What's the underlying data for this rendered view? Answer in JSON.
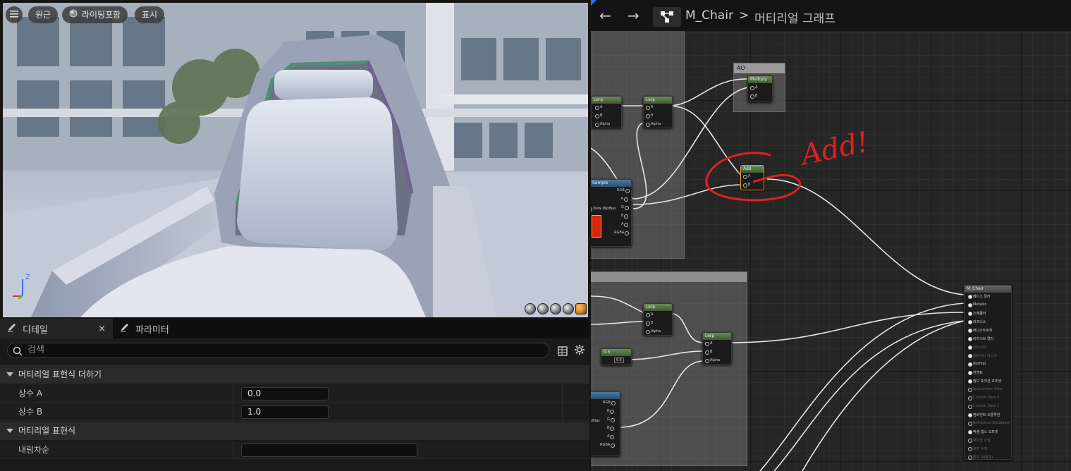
{
  "viewport": {
    "menu_icon": "hamburger-icon",
    "perspective_label": "원근",
    "lighting_label": "라이팅포함",
    "show_label": "표시",
    "axis_z": "Z"
  },
  "details": {
    "tab_details": "디테일",
    "tab_close": "×",
    "tab_params": "파라미터",
    "search_placeholder": "검색",
    "section1": "머티리얼 표현식 더하기",
    "const_a_label": "상수 A",
    "const_a_value": "0.0",
    "const_b_label": "상수 B",
    "const_b_value": "1.0",
    "section2": "머티리얼 표현식",
    "desc_label": "내림차순",
    "desc_value": ""
  },
  "graph": {
    "back": "←",
    "forward": "→",
    "asset": "M_Chair",
    "separator": ">",
    "title": "머티리얼 그래프",
    "annotation": "Add!",
    "comment_ao": "AO",
    "nodes": {
      "lerp": "Lerp",
      "multiply": "Multiply",
      "add": "Add",
      "sample": "Sample",
      "pin_a": "A",
      "pin_b": "B",
      "pin_alpha": "Alpha",
      "pin_rgb": "RGB",
      "pin_r": "R",
      "pin_g": "G",
      "pin_b_ch": "B",
      "pin_rgba": "RGBA",
      "view_mip": "View MipBias",
      "mip_short": "pBias",
      "const_val": "0.5",
      "result_title": "M_Chair",
      "result_pins": [
        "베이스 컬러",
        "Metallic",
        "스페큘러",
        "러프니스",
        "애니소트로피",
        "이미시브 컬러",
        "오파시티",
        "오파시티 마스크",
        "Normal",
        "탄젠트",
        "월드 포지션 오프셋",
        "Subsurface Color",
        "Custom Data 0",
        "Custom Data 1",
        "앰비언트 오클루전",
        "Refraction (Disabled)",
        "픽셀 뎁스 오프셋",
        "셰이딩 모델",
        "표면 두께",
        "변위 (비활성)"
      ]
    }
  }
}
